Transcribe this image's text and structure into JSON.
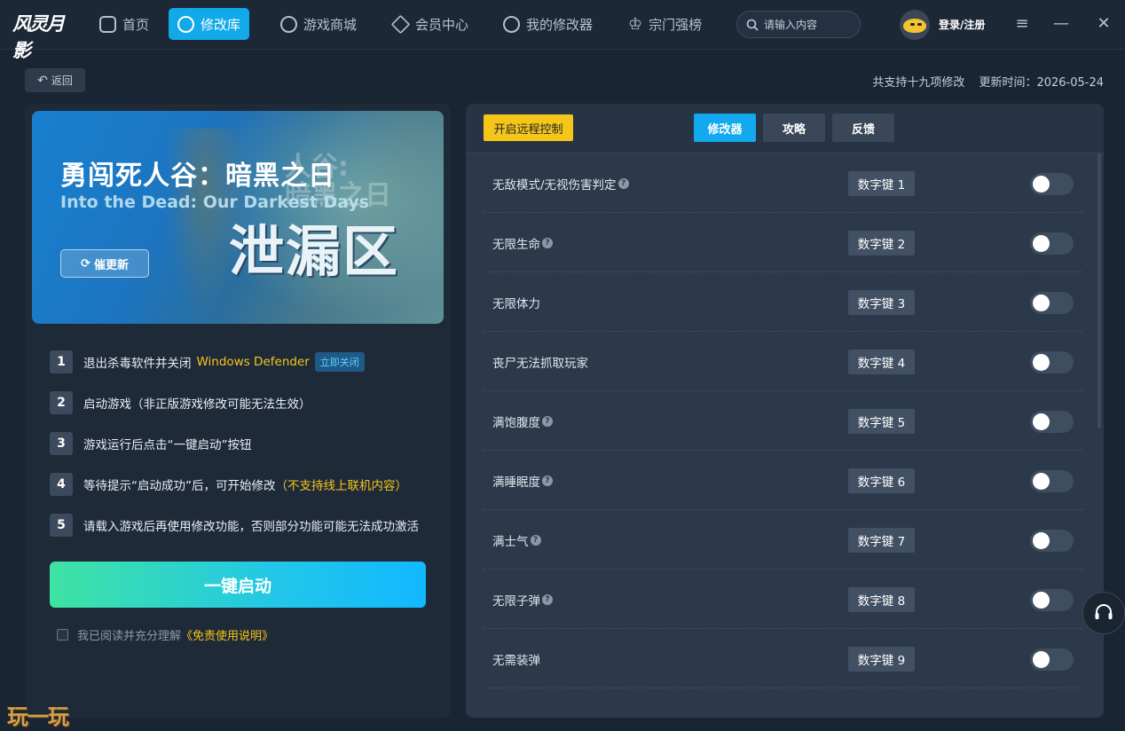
{
  "logo_text": "风灵月影",
  "nav": [
    {
      "label": "首页",
      "icon": "home-icon"
    },
    {
      "label": "修改库",
      "icon": "library-icon"
    },
    {
      "label": "游戏商城",
      "icon": "store-icon"
    },
    {
      "label": "会员中心",
      "icon": "vip-icon"
    },
    {
      "label": "我的修改器",
      "icon": "my-trainer-icon"
    },
    {
      "label": "宗门强榜",
      "icon": "crown-icon"
    }
  ],
  "search": {
    "placeholder": "请输入内容"
  },
  "user": {
    "login_label": "登录/注册"
  },
  "back_label": "返回",
  "meta": {
    "support_count": "共支持十九项修改",
    "update_time": "更新时间：2026-05-24"
  },
  "banner": {
    "title_cn": "勇闯死人谷：暗黑之日",
    "title_en": "Into the Dead: Our Darkest Days",
    "big_text": "泄漏区",
    "ghost_text": "死人谷:\n暗黑之日",
    "urge_label": "催更新"
  },
  "steps": [
    {
      "num": "1",
      "text": "退出杀毒软件并关闭 ",
      "highlight": "Windows Defender",
      "tag": "立即关闭"
    },
    {
      "num": "2",
      "text": "启动游戏（非正版游戏修改可能无法生效）"
    },
    {
      "num": "3",
      "text": "游戏运行后点击“一键启动”按钮"
    },
    {
      "num": "4",
      "text": "等待提示“启动成功”后，可开始修改",
      "highlight": "（不支持线上联机内容）"
    },
    {
      "num": "5",
      "text": "请载入游戏后再使用修改功能，否则部分功能可能无法成功激活"
    }
  ],
  "start_label": "一键启动",
  "agree": {
    "text": "我已阅读并充分理解",
    "link": "《免责使用说明》"
  },
  "watermark": "玩一玩",
  "remote_label": "开启远程控制",
  "tabs": [
    "修改器",
    "攻略",
    "反馈"
  ],
  "cheats": [
    {
      "label": "无敌模式/无视伤害判定",
      "help": true,
      "key": "数字键 1",
      "on": false
    },
    {
      "label": "无限生命",
      "help": true,
      "key": "数字键 2",
      "on": false
    },
    {
      "label": "无限体力",
      "help": false,
      "key": "数字键 3",
      "on": false
    },
    {
      "label": "丧尸无法抓取玩家",
      "help": false,
      "key": "数字键 4",
      "on": false
    },
    {
      "label": "满饱腹度",
      "help": true,
      "key": "数字键 5",
      "on": false
    },
    {
      "label": "满睡眠度",
      "help": true,
      "key": "数字键 6",
      "on": false
    },
    {
      "label": "满士气",
      "help": true,
      "key": "数字键 7",
      "on": false
    },
    {
      "label": "无限子弹",
      "help": true,
      "key": "数字键 8",
      "on": false
    },
    {
      "label": "无需装弹",
      "help": false,
      "key": "数字键 9",
      "on": false
    }
  ],
  "help_glyph": "?",
  "colors": {
    "accent": "#12a9ef",
    "highlight": "#f5c518",
    "bg": "#1a2534"
  }
}
